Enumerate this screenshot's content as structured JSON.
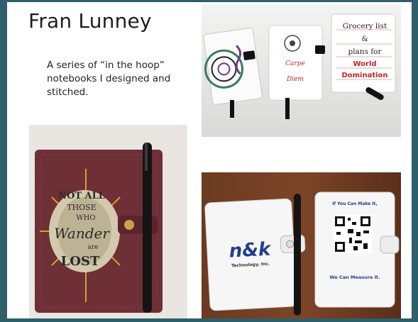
{
  "slide": {
    "title": "Fran Lunney",
    "description": "A series of “in the hoop” notebooks I designed and stitched."
  },
  "photos": {
    "top_right": {
      "carpe": "Carpe",
      "diem": "Diem",
      "grocery_1": "Grocery list",
      "grocery_2": "&",
      "grocery_3": "plans for",
      "grocery_4": "World",
      "grocery_5": "Domination"
    },
    "left": {
      "embroidery_lines": [
        "NOT ALL",
        "THOSE",
        "WHO",
        "Wander",
        "are",
        "LOST"
      ]
    },
    "bottom_right": {
      "logo": "n&k",
      "logo_sub": "Technology, Inc.",
      "tagline_top": "If You Can Make It,",
      "tagline_bottom": "We Can Measure It."
    }
  },
  "colors": {
    "background": "#2f5f6a",
    "slide": "#ffffff",
    "leather": "#6e2f36",
    "brand_blue": "#1f3f8f"
  }
}
